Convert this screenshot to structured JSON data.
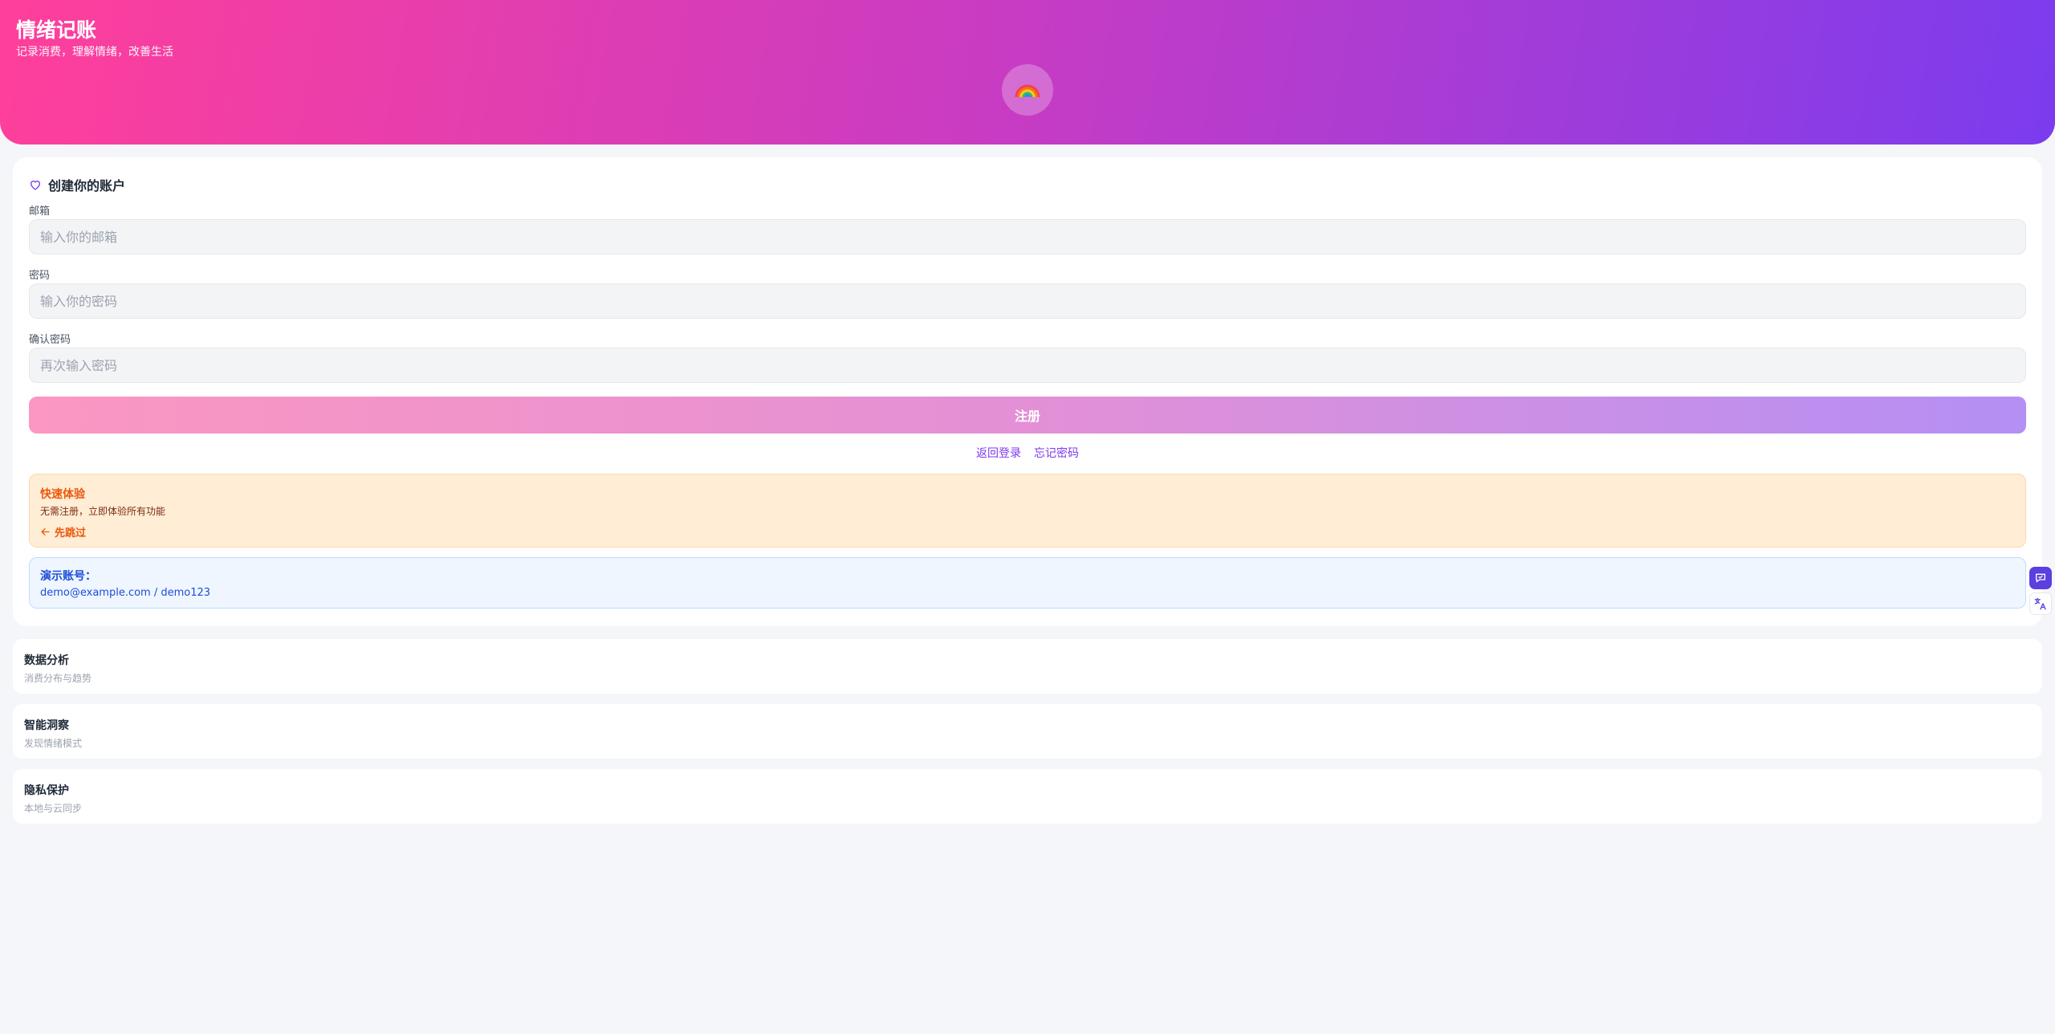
{
  "header": {
    "title": "情绪记账",
    "subtitle": "记录消费，理解情绪，改善生活",
    "logo_icon": "rainbow-icon",
    "gradient_colors": [
      "#ff3f9b",
      "#c63cc4",
      "#7b3cee"
    ]
  },
  "form": {
    "title": "创建你的账户",
    "title_icon": "heart-icon",
    "email": {
      "label": "邮箱",
      "placeholder": "输入你的邮箱",
      "value": ""
    },
    "password": {
      "label": "密码",
      "placeholder": "输入你的密码",
      "value": ""
    },
    "confirm": {
      "label": "确认密码",
      "placeholder": "再次输入密码",
      "value": ""
    },
    "register_label": "注册",
    "back_login": "返回登录",
    "forgot_password": "忘记密码"
  },
  "quick": {
    "title": "快速体验",
    "desc": "无需注册，立即体验所有功能",
    "skip_label": "先跳过"
  },
  "demo": {
    "title": "演示账号：",
    "credentials": "demo@example.com / demo123"
  },
  "features": [
    {
      "title": "数据分析",
      "desc": "消费分布与趋势"
    },
    {
      "title": "智能洞察",
      "desc": "发现情绪模式"
    },
    {
      "title": "隐私保护",
      "desc": "本地与云同步"
    }
  ],
  "floating": {
    "chat_icon": "chat-icon",
    "translate_icon": "translate-icon",
    "accent": "#5b3fe0"
  }
}
